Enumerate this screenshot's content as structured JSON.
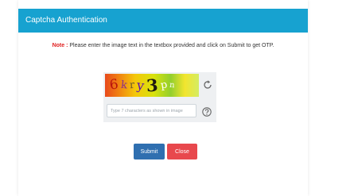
{
  "modal": {
    "title": "Captcha Authentication",
    "header_color": "#17a2d0"
  },
  "note": {
    "label": "Note :",
    "text": "Please enter the image text in the textbox provided and click on Submit to get OTP."
  },
  "captcha": {
    "chars": [
      "6",
      "k",
      "r",
      "y",
      "3",
      "p",
      "n"
    ],
    "input_placeholder": "Type 7 characters as shown in image",
    "input_value": "",
    "refresh_icon": "refresh-icon",
    "help_icon": "help-icon"
  },
  "buttons": {
    "submit_label": "Submit",
    "close_label": "Close",
    "submit_color": "#2f6fb0",
    "close_color": "#e8484d"
  }
}
